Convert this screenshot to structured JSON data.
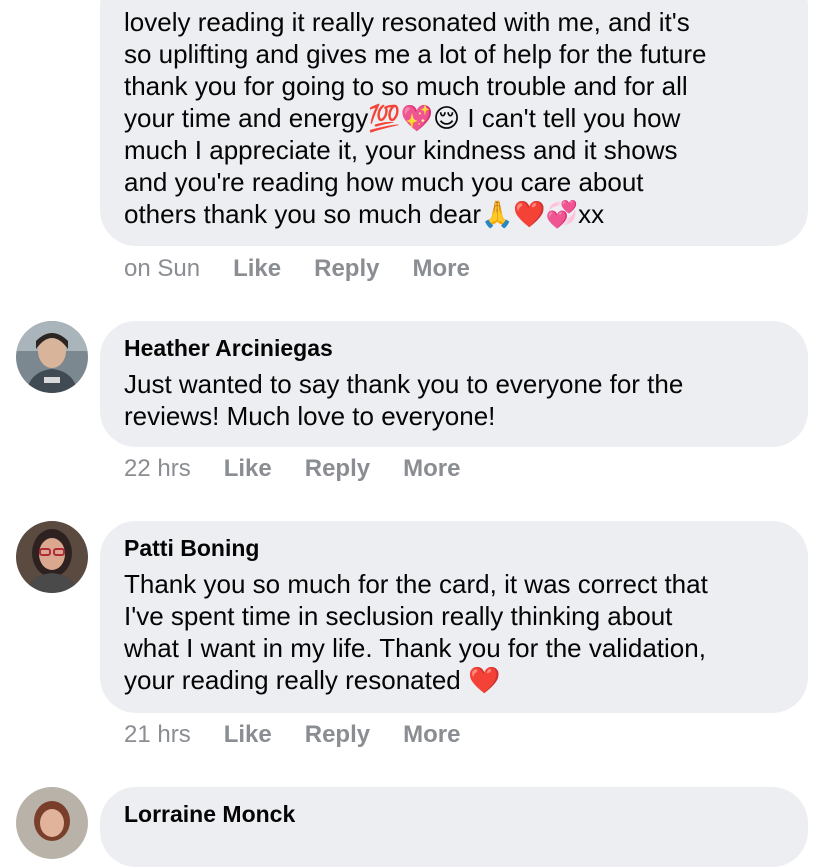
{
  "comments": [
    {
      "name": "",
      "text": "lovely reading it really resonated with me, and it's\nso uplifting and gives me a lot of help for the future\nthank you for going to so much trouble and for all\nyour time and energy💯💖😌 I can't tell you how\nmuch I appreciate it, your kindness and it shows\nand you're reading how much you care about\nothers thank you so much dear🙏❤️💞xx",
      "time": "on Sun",
      "like": "Like",
      "reply": "Reply",
      "more": "More"
    },
    {
      "name": "Heather Arciniegas",
      "text": "Just wanted to say thank you to everyone for the\nreviews! Much love to everyone!",
      "time": "22 hrs",
      "like": "Like",
      "reply": "Reply",
      "more": "More"
    },
    {
      "name": "Patti Boning",
      "text": "Thank you so much for the card, it was correct that\nI've spent time in seclusion really thinking about\nwhat I want in my life. Thank you for the validation,\nyour reading really resonated ❤️",
      "time": "21 hrs",
      "like": "Like",
      "reply": "Reply",
      "more": "More"
    },
    {
      "name": "Lorraine Monck"
    }
  ],
  "colors": {
    "bubble": "#eceef2",
    "meta": "#8a8d91",
    "text": "#050505"
  }
}
